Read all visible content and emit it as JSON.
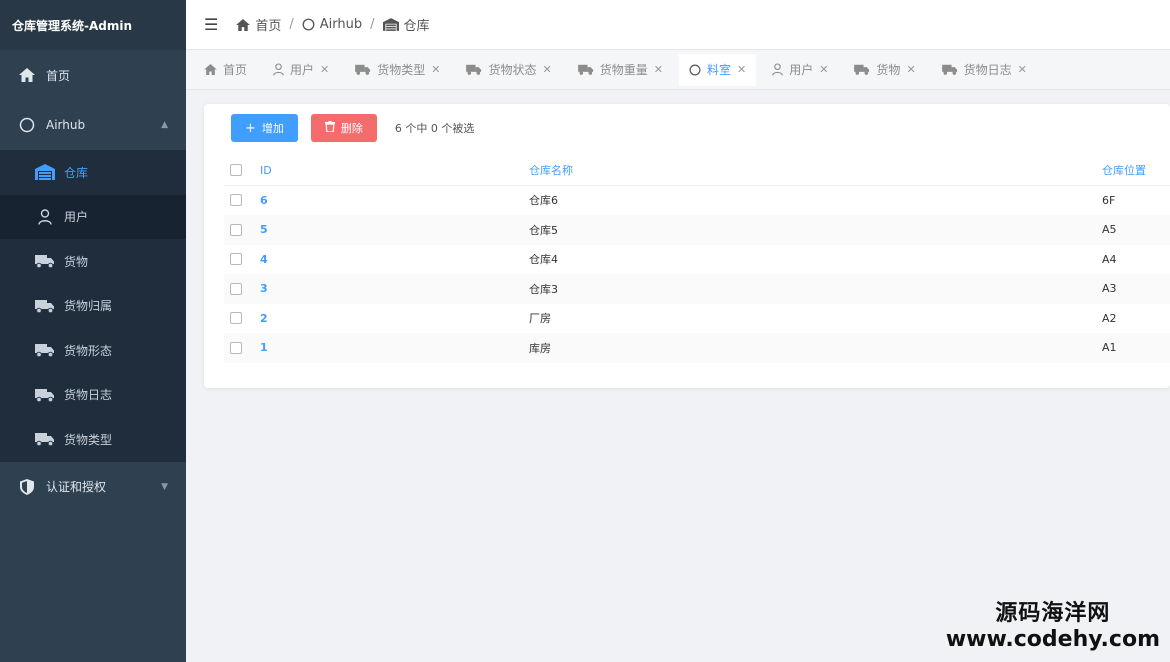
{
  "app": {
    "title": "仓库管理系统-Admin"
  },
  "sidebar": {
    "items": [
      {
        "label": "首页",
        "icon": "home-icon"
      },
      {
        "label": "Airhub",
        "icon": "circle-icon"
      },
      {
        "label": "认证和授权",
        "icon": "shield-icon"
      }
    ],
    "sub": [
      {
        "label": "仓库",
        "icon": "warehouse-icon"
      },
      {
        "label": "用户",
        "icon": "user-icon"
      },
      {
        "label": "货物",
        "icon": "truck-icon"
      },
      {
        "label": "货物归属",
        "icon": "truck-icon"
      },
      {
        "label": "货物形态",
        "icon": "truck-icon"
      },
      {
        "label": "货物日志",
        "icon": "truck-icon"
      },
      {
        "label": "货物类型",
        "icon": "truck-icon"
      }
    ]
  },
  "header": {
    "breadcrumb": [
      "首页",
      "Airhub",
      "仓库"
    ]
  },
  "tabs": [
    {
      "label": "首页"
    },
    {
      "label": "用户"
    },
    {
      "label": "货物类型"
    },
    {
      "label": "货物状态"
    },
    {
      "label": "货物重量"
    },
    {
      "label": "料室"
    },
    {
      "label": "用户"
    },
    {
      "label": "货物"
    },
    {
      "label": "货物日志"
    }
  ],
  "toolbar": {
    "add_label": "增加",
    "delete_label": "删除",
    "selection_text": "6 个中 0 个被选"
  },
  "table": {
    "columns": [
      "ID",
      "仓库名称",
      "仓库位置"
    ],
    "rows": [
      [
        "6",
        "仓库6",
        "6F"
      ],
      [
        "5",
        "仓库5",
        "A5"
      ],
      [
        "4",
        "仓库4",
        "A4"
      ],
      [
        "3",
        "仓库3",
        "A3"
      ],
      [
        "2",
        "厂房",
        "A2"
      ],
      [
        "1",
        "库房",
        "A1"
      ]
    ]
  },
  "watermark": {
    "line1": "源码海洋网",
    "line2": "www.codehy.com"
  },
  "colors": {
    "sidebar": "#2f4050",
    "accent": "#409eff",
    "danger": "#f56c6c"
  }
}
